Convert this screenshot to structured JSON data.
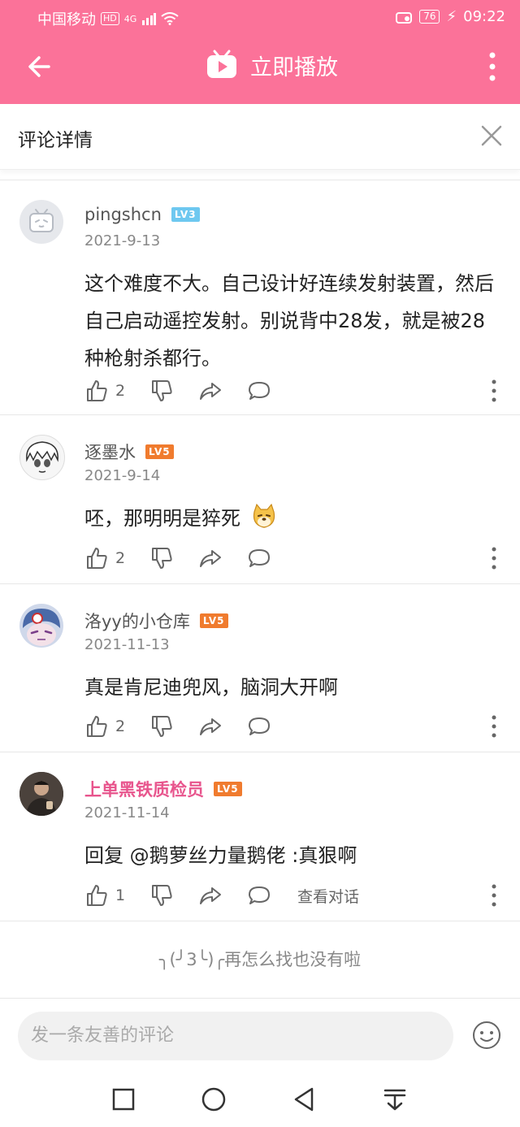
{
  "status": {
    "carrier": "中国移动",
    "hd": "HD",
    "network": "4G",
    "battery": "76",
    "time": "09:22"
  },
  "appbar": {
    "title": "立即播放"
  },
  "panel": {
    "title": "评论详情"
  },
  "comments": [
    {
      "user": "pingshcn",
      "level": "LV3",
      "date": "2021-9-13",
      "text": "这个难度不大。自己设计好连续发射装置，然后自己启动遥控发射。别说背中28发，就是被28种枪射杀都行。",
      "likes": "2"
    },
    {
      "user": "逐墨水",
      "level": "LV5",
      "date": "2021-9-14",
      "text": "呸，那明明是猝死",
      "likes": "2"
    },
    {
      "user": "洛yy的小仓库",
      "level": "LV5",
      "date": "2021-11-13",
      "text": "真是肯尼迪兜风，脑洞大开啊",
      "likes": "2"
    },
    {
      "user": "上单黑铁质检员",
      "level": "LV5",
      "date": "2021-11-14",
      "text": "回复 @鹅萝丝力量鹅佬 :真狠啊",
      "likes": "1",
      "view_conversation": "查看对话"
    }
  ],
  "end_text": "╮(╯3╰)╭再怎么找也没有啦",
  "input": {
    "placeholder": "发一条友善的评论"
  },
  "colors": {
    "brand": "#fb7299",
    "lv3": "#6ec8f0",
    "lv5": "#f07b2e",
    "vip_name": "#e8558d"
  }
}
